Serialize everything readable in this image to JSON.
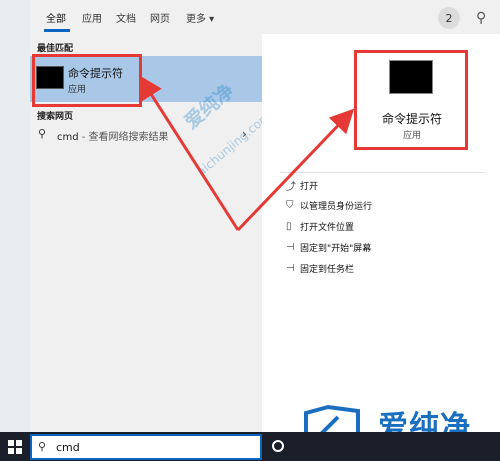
{
  "tabs": [
    "全部",
    "应用",
    "文档",
    "网页",
    "更多 ▾"
  ],
  "badge_count": "2",
  "sections": {
    "best_match": "最佳匹配",
    "web": "搜索网页"
  },
  "best_match": {
    "title": "命令提示符",
    "subtitle": "应用"
  },
  "web_result": {
    "query": "cmd",
    "suffix": " - 查看网络搜索结果"
  },
  "details": {
    "name": "命令提示符",
    "kind": "应用",
    "actions": [
      "打开",
      "以管理员身份运行",
      "打开文件位置",
      "固定到\"开始\"屏幕",
      "固定到任务栏"
    ]
  },
  "search": {
    "value": "cmd"
  },
  "watermark": {
    "text": "爱纯净",
    "domain": "aichunjing.com"
  },
  "colors": {
    "accent": "#0a64c2",
    "highlight": "#a9c8e8",
    "annotation": "#e53935"
  }
}
